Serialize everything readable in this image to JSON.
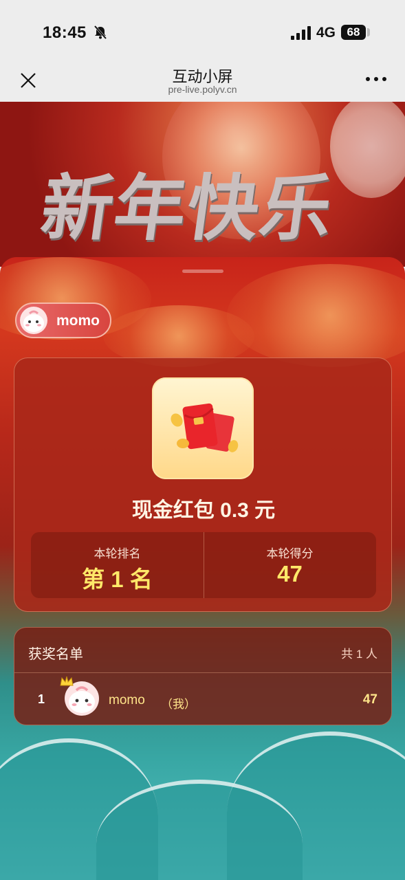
{
  "status_bar": {
    "time": "18:45",
    "network": "4G",
    "battery": "68",
    "icons": [
      "bell-muted-icon",
      "signal-icon",
      "battery-icon"
    ]
  },
  "nav": {
    "title": "互动小屏",
    "subtitle": "pre-live.polyv.cn",
    "icons": [
      "close-icon",
      "more-icon"
    ]
  },
  "banner": {
    "title": "新年快乐"
  },
  "user": {
    "name": "momo"
  },
  "prize": {
    "title": "现金红包 0.3 元",
    "icon": "red-envelope-icon",
    "stats": [
      {
        "label": "本轮排名",
        "value": "第 1 名"
      },
      {
        "label": "本轮得分",
        "value": "47"
      }
    ]
  },
  "winners": {
    "title": "获奖名单",
    "count": "共 1 人",
    "rows": [
      {
        "rank": "1",
        "name": "momo",
        "me_tag": "（我）",
        "score": "47"
      }
    ]
  },
  "colors": {
    "accent_gold": "#ffe869",
    "card_red": "#aa2819",
    "pill_red": "#d8453f"
  }
}
